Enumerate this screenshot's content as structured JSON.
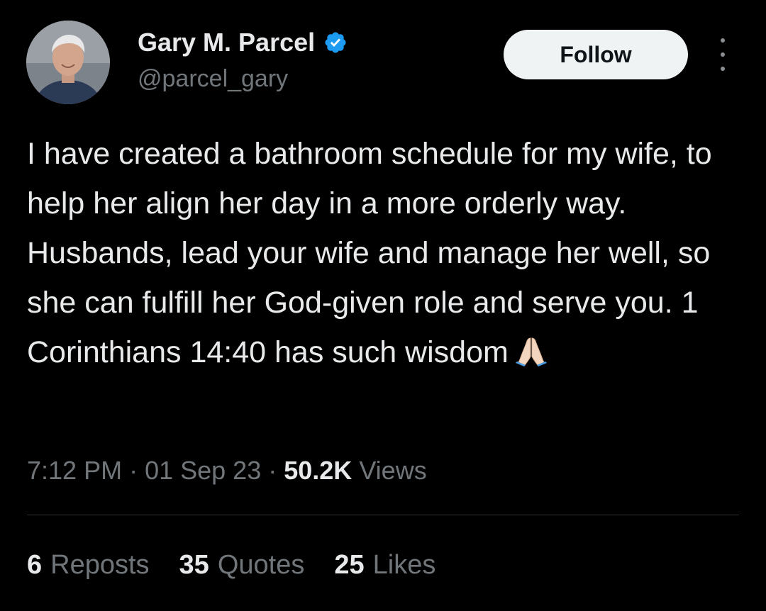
{
  "author": {
    "display_name": "Gary M. Parcel",
    "handle": "@parcel_gary",
    "verified": true,
    "avatar_icon": "profile-photo-avatar"
  },
  "actions": {
    "follow_label": "Follow",
    "more_icon": "more-vertical-icon"
  },
  "tweet": {
    "text": "I have created a bathroom schedule for my wife, to help her align her day in a more orderly way. Husbands, lead your wife and manage her well, so she can fulfill her God-given role and serve you. 1 Corinthians 14:40 has such wisdom",
    "emoji": "folded-hands-emoji"
  },
  "meta": {
    "time": "7:12 PM",
    "separator": "·",
    "date": "01 Sep 23",
    "views_count": "50.2K",
    "views_label": "Views"
  },
  "stats": [
    {
      "count": "6",
      "label": "Reposts"
    },
    {
      "count": "35",
      "label": "Quotes"
    },
    {
      "count": "25",
      "label": "Likes"
    }
  ],
  "colors": {
    "background": "#000000",
    "primary_text": "#e7e9ea",
    "secondary_text": "#71767b",
    "verified_blue": "#1d9bf0",
    "follow_button_bg": "#eff3f4",
    "divider": "#2f3336"
  }
}
